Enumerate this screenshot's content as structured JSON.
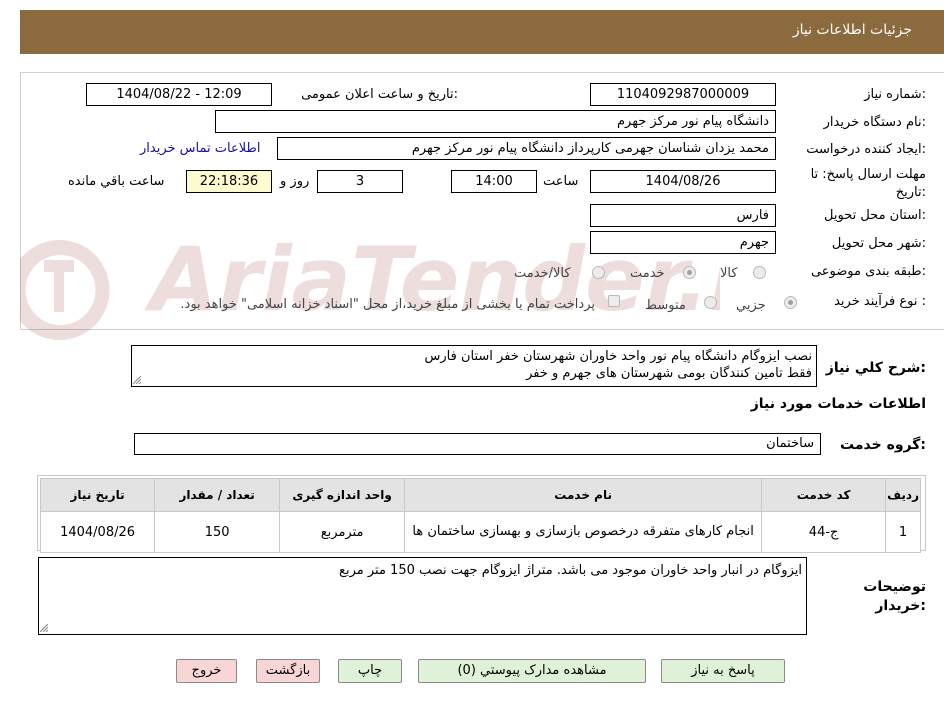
{
  "header": {
    "title": "جزئیات اطلاعات نیاز"
  },
  "form": {
    "need_number_label": "شماره نیاز:",
    "need_number": "1104092987000009",
    "announce_label": "تاریخ و ساعت اعلان عمومی:",
    "announce_value": "1404/08/22 - 12:09",
    "buyer_org_label": "نام دستگاه خریدار:",
    "buyer_org": "دانشگاه پیام نور مرکز جهرم",
    "requester_label": "ایجاد کننده درخواست:",
    "requester": "محمد یزدان شناسان جهرمی کارپرداز دانشگاه پیام نور مرکز جهرم",
    "contact_link": "اطلاعات تماس خریدار",
    "deadline_label": "مهلت ارسال پاسخ: تا تاریخ:",
    "deadline_date": "1404/08/26",
    "hour_label": "ساعت",
    "deadline_time": "14:00",
    "days_value": "3",
    "days_label": "روز و",
    "remaining_time": "22:18:36",
    "remaining_label": "ساعت باقي مانده",
    "province_label": "استان محل تحویل:",
    "province": "فارس",
    "city_label": "شهر محل تحویل:",
    "city": "جهرم",
    "category_label": "طبقه بندی موضوعی:",
    "category_options": [
      "کالا",
      "خدمت",
      "کالا/خدمت"
    ],
    "category_selected": "خدمت",
    "process_label": "نوع فرآیند خرید :",
    "process_options": [
      "جزیي",
      "متوسط"
    ],
    "process_selected": "جزیي",
    "payment_note": "پرداخت تمام یا بخشی از مبلغ خرید،از محل \"اسناد خزانه اسلامی\" خواهد بود."
  },
  "description": {
    "label": "شرح كلي نياز:",
    "line1": "نصب ایزوگام دانشگاه پیام نور واحد خاوران شهرستان خفر استان فارس",
    "line2": "فقط تامین کنندگان بومی شهرستان های جهرم و خفر"
  },
  "services": {
    "section_title": "اطلاعات خدمات مورد نیاز",
    "group_label": "گروه خدمت:",
    "group_value": "ساختمان",
    "columns": [
      "رديف",
      "کد خدمت",
      "نام خدمت",
      "واحد اندازه گیری",
      "تعداد / مقدار",
      "تاریخ نیاز"
    ],
    "rows": [
      {
        "row": "1",
        "code": "ج-44",
        "name": "انجام کارهای متفرقه درخصوص بازسازی و بهسازی ساختمان ها",
        "unit": "مترمربع",
        "qty": "150",
        "date": "1404/08/26"
      }
    ]
  },
  "buyer_notes": {
    "label": "توضیحات خریدار:",
    "text": "ایزوگام در انبار واحد خاوران موجود می باشد. متراژ ایزوگام جهت نصب 150 متر مربع"
  },
  "buttons": {
    "reply": "پاسخ به نیاز",
    "attachments": "مشاهده مدارک پیوستي (0)",
    "print": "چاپ",
    "back": "بازگشت",
    "exit": "خروج"
  },
  "watermark": {
    "text": "AriaTender.neT"
  },
  "icons": {
    "resize_handle": "resize-grip-icon",
    "watermark_logo": "ariatender-logo"
  }
}
